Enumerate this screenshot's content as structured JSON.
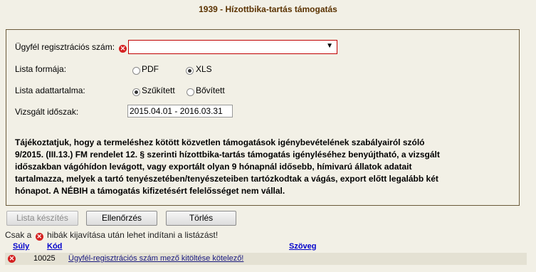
{
  "page": {
    "title": "1939 - Hízottbika-tartás támogatás"
  },
  "form": {
    "client_reg_label": "Ügyfél regisztrációs szám:",
    "client_reg_value": "",
    "list_format_label": "Lista formája:",
    "format_options": [
      "PDF",
      "XLS"
    ],
    "format_selected": "XLS",
    "list_content_label": "Lista adattartalma:",
    "content_options": [
      "Szűkített",
      "Bővített"
    ],
    "content_selected": "Szűkített",
    "period_label": "Vizsgált időszak:",
    "period_value": "2015.04.01 - 2016.03.31",
    "notice": "Tájékoztatjuk, hogy a termeléshez kötött közvetlen támogatások igénybevételének szabályairól szóló 9/2015. (III.13.) FM rendelet 12. § szerinti hízottbika-tartás támogatás igényléséhez benyújtható, a vizsgált időszakban vágóhídon levágott, vagy exportált olyan 9 hónapnál idősebb, hímivarú állatok adatait tartalmazza, melyek a tartó tenyészetében/tenyészeteiben tartózkodtak a vágás, export előtt legalább két hónapot. A NÉBIH a támogatás kifizetésért felelősséget nem vállal."
  },
  "buttons": {
    "create": "Lista készítés",
    "check": "Ellenőrzés",
    "delete": "Törlés"
  },
  "message": {
    "prefix": "Csak a",
    "suffix": "hibák kijavítása után lehet indítani a listázást!"
  },
  "errors_table": {
    "headers": {
      "severity": "Súly",
      "code": "Kód",
      "text": "Szöveg"
    },
    "rows": [
      {
        "code": "10025",
        "text": "Ügyfél-regisztrációs szám mező kitöltése kötelező!"
      }
    ]
  },
  "colors": {
    "background": "#f2f0e6",
    "error": "#d42020",
    "title": "#5a3200"
  },
  "icons": {
    "error": "error-icon",
    "dropdown": "chevron-down-icon"
  }
}
